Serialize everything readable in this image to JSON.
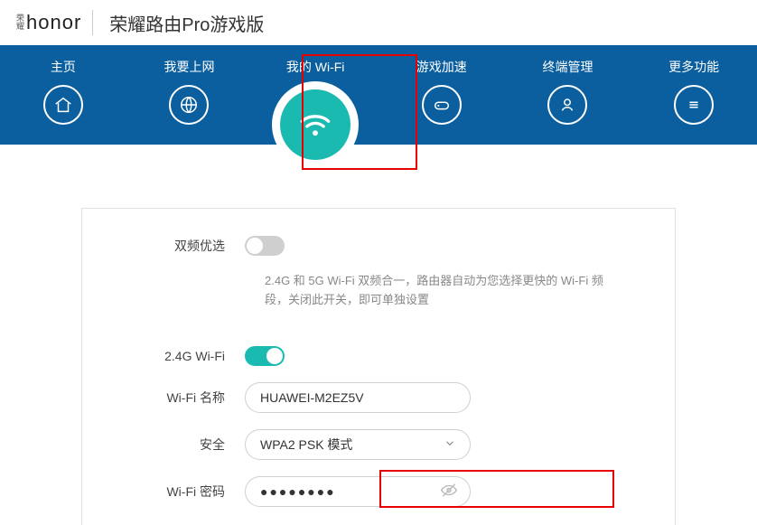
{
  "header": {
    "brand_small_top": "荣",
    "brand_small_bot": "耀",
    "brand": "honor",
    "product": "荣耀路由Pro游戏版"
  },
  "nav": {
    "items": [
      {
        "label": "主页"
      },
      {
        "label": "我要上网"
      },
      {
        "label": "我的 Wi-Fi"
      },
      {
        "label": "游戏加速"
      },
      {
        "label": "终端管理"
      },
      {
        "label": "更多功能"
      }
    ]
  },
  "settings": {
    "dual_band_label": "双频优选",
    "dual_band_on": false,
    "dual_band_help": "2.4G 和 5G Wi-Fi 双频合一，路由器自动为您选择更快的 Wi-Fi 频段，关闭此开关，即可单独设置",
    "wifi24_label": "2.4G Wi-Fi",
    "wifi24_on": true,
    "name_label": "Wi-Fi 名称",
    "name_value": "HUAWEI-M2EZ5V",
    "security_label": "安全",
    "security_value": "WPA2 PSK 模式",
    "password_label": "Wi-Fi 密码",
    "password_value": "●●●●●●●●"
  },
  "colors": {
    "brand_teal": "#1abab0",
    "nav_blue": "#0b5f9e",
    "highlight": "#e60000"
  }
}
